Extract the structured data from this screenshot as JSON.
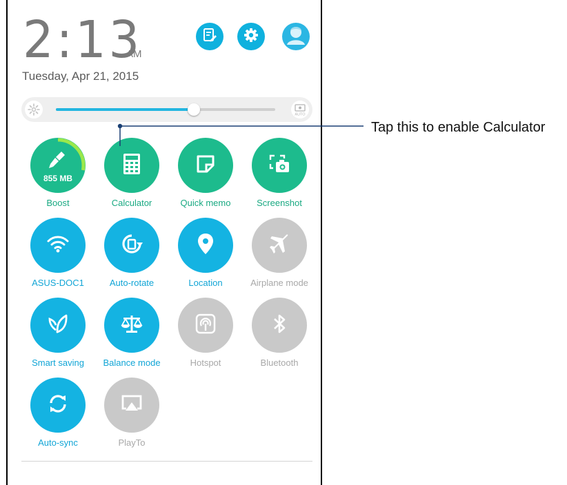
{
  "clock": {
    "time": "2:13",
    "ampm": "AM",
    "date": "Tuesday, Apr 21, 2015"
  },
  "header_buttons": [
    "edit-icon",
    "gear-icon",
    "user-icon"
  ],
  "brightness": {
    "level": 0.63,
    "auto_label": "AUTO"
  },
  "tiles": [
    {
      "label": "Boost",
      "state": "green",
      "icon": "broom-icon",
      "value": "855 MB",
      "ring_fraction": 0.28
    },
    {
      "label": "Calculator",
      "state": "green",
      "icon": "calculator-icon"
    },
    {
      "label": "Quick memo",
      "state": "green",
      "icon": "memo-icon"
    },
    {
      "label": "Screenshot",
      "state": "green",
      "icon": "screenshot-icon"
    },
    {
      "label": "ASUS-DOC1",
      "state": "blue",
      "icon": "wifi-icon"
    },
    {
      "label": "Auto-rotate",
      "state": "blue",
      "icon": "rotate-icon"
    },
    {
      "label": "Location",
      "state": "blue",
      "icon": "location-icon"
    },
    {
      "label": "Airplane mode",
      "state": "gray",
      "icon": "airplane-icon"
    },
    {
      "label": "Smart saving",
      "state": "blue",
      "icon": "leaf-icon"
    },
    {
      "label": "Balance mode",
      "state": "blue",
      "icon": "balance-icon"
    },
    {
      "label": "Hotspot",
      "state": "gray",
      "icon": "hotspot-icon"
    },
    {
      "label": "Bluetooth",
      "state": "gray",
      "icon": "bluetooth-icon"
    },
    {
      "label": "Auto-sync",
      "state": "blue",
      "icon": "sync-icon"
    },
    {
      "label": "PlayTo",
      "state": "gray",
      "icon": "playto-icon"
    }
  ],
  "callout": {
    "text": "Tap this to enable Calculator"
  },
  "colors": {
    "green": "#1dbb8d",
    "blue": "#14b3e2",
    "gray": "#c9c9c9",
    "accent": "#23b6e0"
  }
}
